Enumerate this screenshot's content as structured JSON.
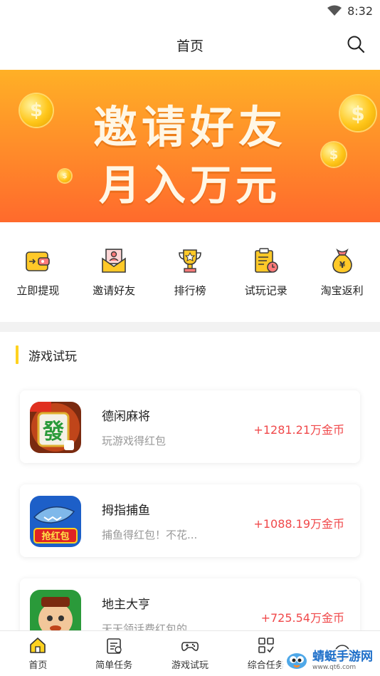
{
  "status_bar": {
    "time": "8:32"
  },
  "header": {
    "title": "首页"
  },
  "banner": {
    "line1": "邀请好友",
    "line2": "月入万元"
  },
  "quick_actions": [
    {
      "label": "立即提现",
      "icon": "wallet-icon"
    },
    {
      "label": "邀请好友",
      "icon": "invite-envelope-icon"
    },
    {
      "label": "排行榜",
      "icon": "trophy-icon"
    },
    {
      "label": "试玩记录",
      "icon": "record-clipboard-icon"
    },
    {
      "label": "淘宝返利",
      "icon": "money-bag-icon"
    }
  ],
  "section": {
    "title": "游戏试玩"
  },
  "games": [
    {
      "name": "德闲麻将",
      "desc": "玩游戏得红包",
      "reward": "+1281.21万金币"
    },
    {
      "name": "拇指捕鱼",
      "desc": "捕鱼得红包！不花...",
      "reward": "+1088.19万金币"
    },
    {
      "name": "地主大亨",
      "desc": "天天领话费红包的",
      "reward": "+725.54万金币"
    }
  ],
  "tabs": [
    {
      "label": "首页",
      "icon": "home-icon"
    },
    {
      "label": "简单任务",
      "icon": "task-icon"
    },
    {
      "label": "游戏试玩",
      "icon": "gamepad-icon"
    },
    {
      "label": "综合任务",
      "icon": "grid-icon"
    },
    {
      "label": "",
      "icon": "face-icon"
    }
  ],
  "watermark": {
    "main": "蜻蜓手游网",
    "sub": "www.qt6.com"
  },
  "colors": {
    "accent": "#ffd21f",
    "reward": "#f0484a",
    "banner_top": "#ffb026",
    "banner_bottom": "#ff6a2c"
  }
}
